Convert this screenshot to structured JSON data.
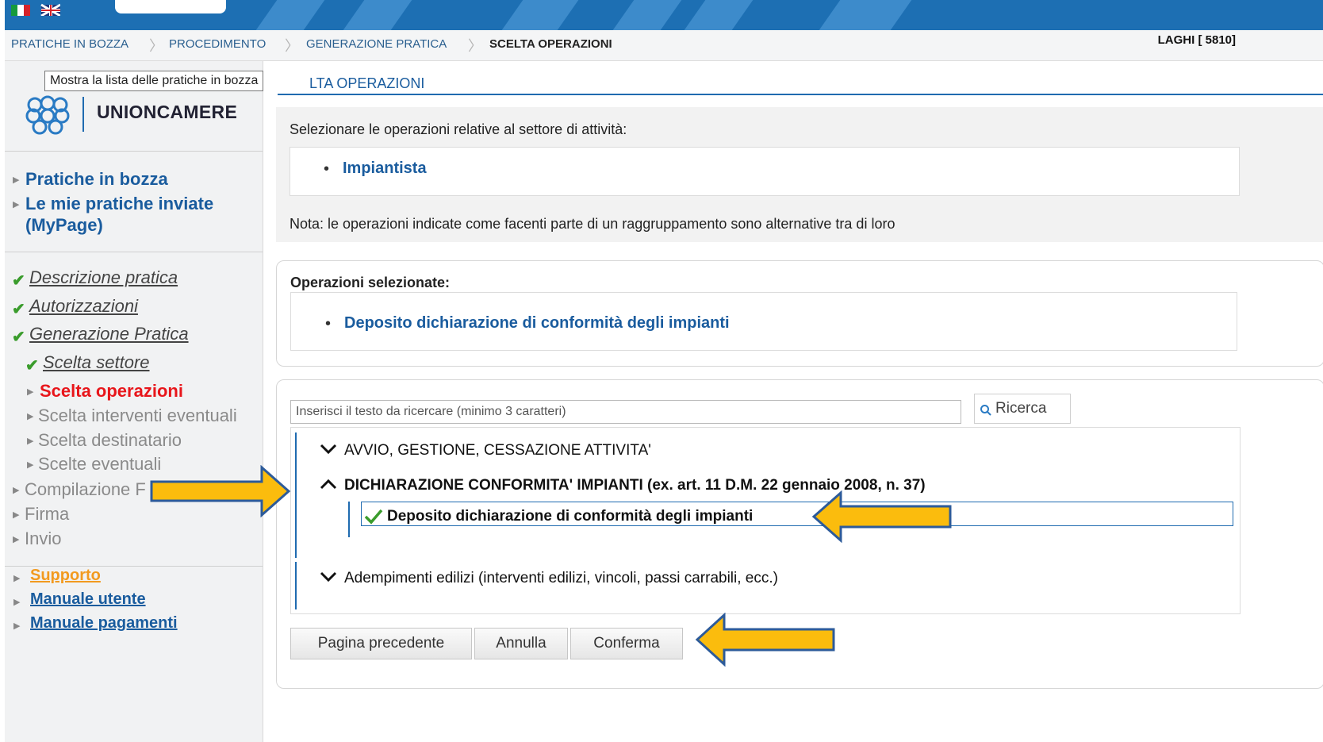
{
  "breadcrumb": [
    "PRATICHE IN BOZZA",
    "PROCEDIMENTO",
    "GENERAZIONE PRATICA",
    "SCELTA OPERAZIONI"
  ],
  "user": "LAGHI [ 5810]",
  "tooltip": "Mostra la lista delle pratiche in bozza",
  "logo_text": "UNIONCAMERE",
  "sidebar": {
    "links": [
      "Pratiche in bozza",
      "Le mie pratiche inviate",
      "(MyPage)"
    ],
    "steps_done": [
      "Descrizione pratica",
      "Autorizzazioni",
      "Generazione Pratica",
      "Scelta settore"
    ],
    "step_active": "Scelta operazioni",
    "steps_pending": [
      "Scelta interventi eventuali",
      "Scelta destinatario",
      "Scelte eventuali",
      "Compilazione F",
      "Firma",
      "Invio"
    ],
    "support": [
      "Supporto",
      "Manuale utente",
      "Manuale pagamenti"
    ]
  },
  "main": {
    "title": "LTA OPERAZIONI",
    "intro": "Selezionare le operazioni relative al settore di attività:",
    "sector": "Impiantista",
    "note": "Nota: le operazioni indicate come facenti parte di un raggruppamento sono alternative tra di loro",
    "selected_label": "Operazioni selezionate:",
    "selected_item": "Deposito dichiarazione di conformità degli impianti",
    "search_placeholder": "Inserisci il testo da ricercare (minimo 3 caratteri)",
    "search_button": "Ricerca",
    "tree": {
      "group1": "AVVIO, GESTIONE, CESSAZIONE ATTIVITA'",
      "group2": "DICHIARAZIONE CONFORMITA' IMPIANTI (ex. art. 11 D.M. 22 gennaio 2008, n. 37)",
      "group2_item": "Deposito dichiarazione di conformità degli impianti",
      "group3": "Adempimenti edilizi (interventi edilizi, vincoli, passi carrabili, ecc.)"
    },
    "buttons": {
      "prev": "Pagina precedente",
      "cancel": "Annulla",
      "confirm": "Conferma"
    }
  },
  "colors": {
    "accent": "#1a5c9e",
    "active": "#e8161b",
    "check": "#3a9c2c",
    "arrow_fill": "#fbbc0d"
  }
}
